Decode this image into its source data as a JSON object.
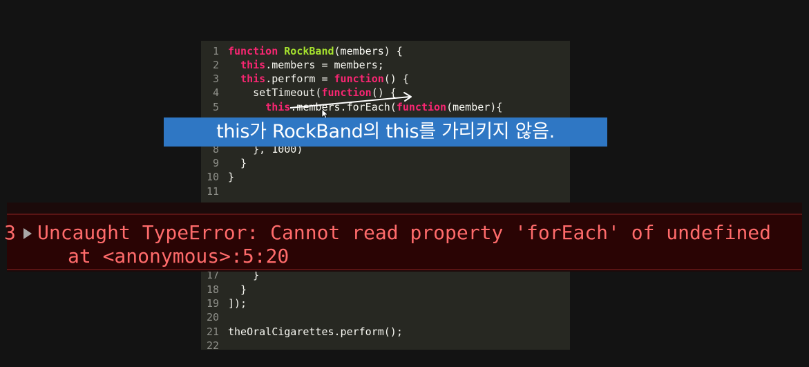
{
  "editor": {
    "lines": [
      {
        "num": "1",
        "parts": [
          {
            "t": "function",
            "c": "kw"
          },
          {
            "t": " "
          },
          {
            "t": "RockBand",
            "c": "fn"
          },
          {
            "t": "(members) {"
          }
        ]
      },
      {
        "num": "2",
        "parts": [
          {
            "t": "  "
          },
          {
            "t": "this",
            "c": "th"
          },
          {
            "t": ".members = members;"
          }
        ]
      },
      {
        "num": "3",
        "parts": [
          {
            "t": "  "
          },
          {
            "t": "this",
            "c": "th"
          },
          {
            "t": ".perform = "
          },
          {
            "t": "function",
            "c": "kw"
          },
          {
            "t": "() {"
          }
        ]
      },
      {
        "num": "4",
        "parts": [
          {
            "t": "    setTimeout("
          },
          {
            "t": "function",
            "c": "kw"
          },
          {
            "t": "() {"
          }
        ]
      },
      {
        "num": "5",
        "parts": [
          {
            "t": "      "
          },
          {
            "t": "this",
            "c": "th"
          },
          {
            "t": ".members.forEach("
          },
          {
            "t": "function",
            "c": "kw"
          },
          {
            "t": "(member){"
          }
        ]
      },
      {
        "num": "8",
        "parts": [
          {
            "t": "    }, 1000)"
          }
        ]
      },
      {
        "num": "9",
        "parts": [
          {
            "t": "  }"
          }
        ]
      },
      {
        "num": "10",
        "parts": [
          {
            "t": "}"
          }
        ]
      },
      {
        "num": "11",
        "parts": [
          {
            "t": ""
          }
        ]
      },
      {
        "num": "17",
        "parts": [
          {
            "t": "    }"
          }
        ]
      },
      {
        "num": "18",
        "parts": [
          {
            "t": "  }"
          }
        ]
      },
      {
        "num": "19",
        "parts": [
          {
            "t": "]);"
          }
        ]
      },
      {
        "num": "20",
        "parts": [
          {
            "t": ""
          }
        ]
      },
      {
        "num": "21",
        "parts": [
          {
            "t": "theOralCigarettes.perform();"
          }
        ]
      },
      {
        "num": "22",
        "parts": [
          {
            "t": ""
          }
        ]
      }
    ]
  },
  "caption": {
    "text": "this가 RockBand의 this를 가리키지 않음."
  },
  "console_error": {
    "line1": "Uncaught TypeError: Cannot read property 'forEach' of undefined",
    "line2": "at <anonymous>:5:20",
    "left_glyph": "3",
    "expand_icon": "triangle-right-icon"
  },
  "colors": {
    "background": "#131313",
    "editor_bg": "#272822",
    "keyword": "#f92672",
    "function_name": "#a6e22e",
    "caption_bg": "#2f77c4",
    "error_text": "#ff6b6b",
    "error_bg": "#2a0404"
  }
}
